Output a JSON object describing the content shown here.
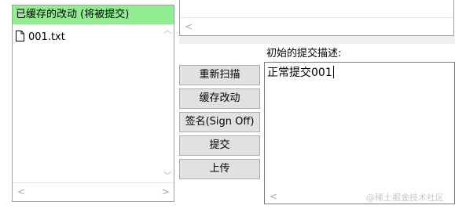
{
  "staged": {
    "header": "已缓存的改动 (将被提交)",
    "files": [
      {
        "name": "001.txt",
        "icon": "file-icon"
      }
    ]
  },
  "buttons": {
    "rescan": "重新扫描",
    "stage": "缓存改动",
    "signoff": "签名(Sign Off)",
    "commit": "提交",
    "push": "上传"
  },
  "commit_message": {
    "label": "初始的提交描述:",
    "value": "正常提交001"
  },
  "watermark": "@稀土掘金技术社区",
  "colors": {
    "staged_header_bg": "#90ee90",
    "button_bg": "#e1e1e1",
    "button_border": "#adadad",
    "panel_border": "#a0a0a0"
  }
}
